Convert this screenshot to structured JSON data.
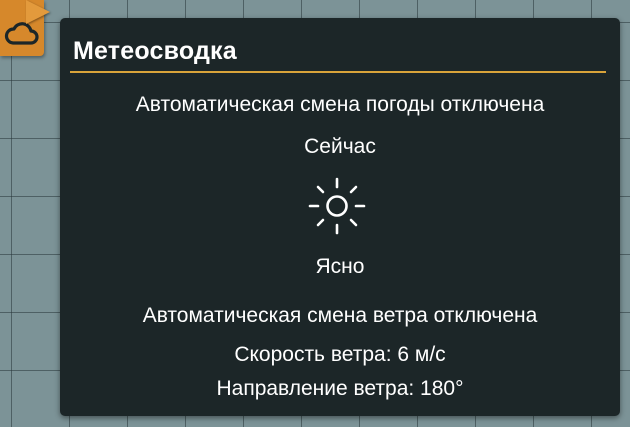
{
  "panel": {
    "title": "Метеосводка",
    "weather_status": "Автоматическая смена погоды отключена",
    "now_label": "Сейчас",
    "condition_icon": "sun-icon",
    "condition": "Ясно",
    "wind_status": "Автоматическая смена ветра отключена",
    "wind_speed": "Скорость ветра: 6 м/с",
    "wind_direction": "Направление ветра: 180°"
  },
  "toolbar": {
    "weather_button_icon": "cloud-icon"
  },
  "colors": {
    "panel_background": "#1c2628",
    "accent_rule": "#d8a33a",
    "button_orange": "#d6882b",
    "map_background": "#7c9397",
    "text": "#ffffff"
  }
}
